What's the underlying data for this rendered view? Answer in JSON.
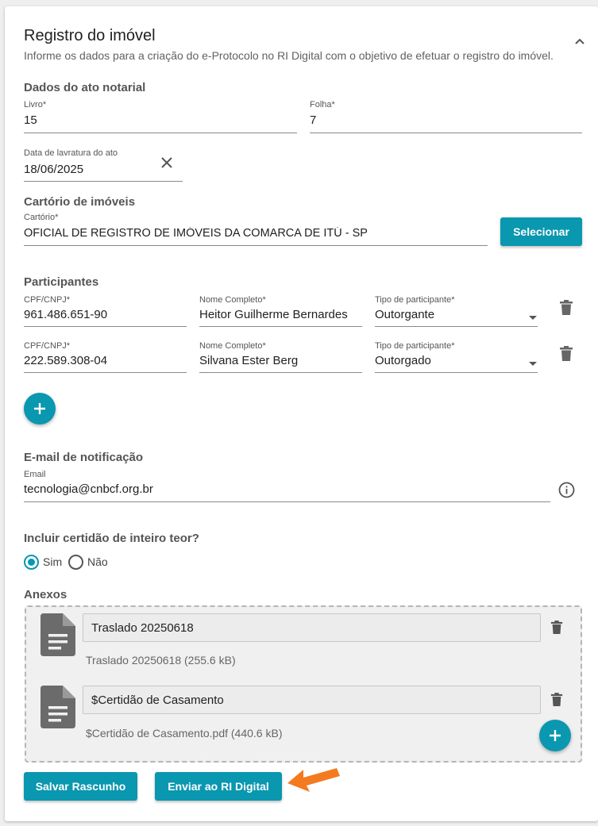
{
  "header": {
    "title": "Registro do imóvel",
    "subtitle": "Informe os dados para a criação do e-Protocolo no RI Digital com o objetivo de efetuar o registro do imóvel."
  },
  "notarial": {
    "section_title": "Dados do ato notarial",
    "livro_label": "Livro*",
    "livro_value": "15",
    "folha_label": "Folha*",
    "folha_value": "7",
    "data_label": "Data de lavratura do ato",
    "data_value": "18/06/2025"
  },
  "cartorio": {
    "section_title": "Cartório de imóveis",
    "label": "Cartório*",
    "value": "OFICIAL DE REGISTRO DE IMÓVEIS DA COMARCA DE ITÚ - SP",
    "select_label": "Selecionar"
  },
  "participants": {
    "section_title": "Participantes",
    "rows": [
      {
        "cpf_label": "CPF/CNPJ*",
        "cpf": "961.486.651-90",
        "name_label": "Nome Completo*",
        "name": "Heitor Guilherme Bernardes",
        "type_label": "Tipo de participante*",
        "type": "Outorgante"
      },
      {
        "cpf_label": "CPF/CNPJ*",
        "cpf": "222.589.308-04",
        "name_label": "Nome Completo*",
        "name": "Silvana Ester Berg",
        "type_label": "Tipo de participante*",
        "type": "Outorgado"
      }
    ]
  },
  "email": {
    "section_title": "E-mail de notificação",
    "label": "Email",
    "value": "tecnologia@cnbcf.org.br"
  },
  "certidao": {
    "question": "Incluir certidão de inteiro teor?",
    "options": [
      "Sim",
      "Não"
    ],
    "selected": "Sim"
  },
  "anexos": {
    "section_title": "Anexos",
    "items": [
      {
        "name": "Traslado 20250618",
        "file": "Traslado 20250618 (255.6 kB)"
      },
      {
        "name": "$Certidão de Casamento",
        "file": "$Certidão de Casamento.pdf (440.6 kB)"
      }
    ]
  },
  "actions": {
    "save_label": "Salvar Rascunho",
    "send_label": "Enviar ao RI Digital"
  },
  "colors": {
    "accent": "#0a97b0",
    "arrow": "#f47a1f"
  },
  "icons": [
    "chevron-up-icon",
    "clear-icon",
    "delete-icon",
    "dropdown-arrow-icon",
    "add-icon",
    "info-icon",
    "document-icon",
    "arrow-annotation-icon"
  ]
}
